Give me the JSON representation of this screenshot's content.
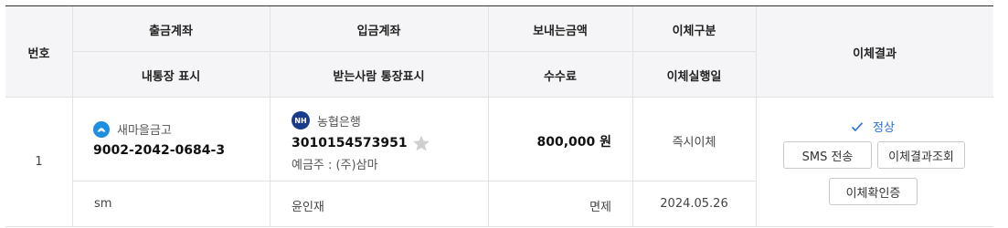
{
  "headers": {
    "number": "번호",
    "from_account": "출금계좌",
    "to_account": "입금계좌",
    "amount": "보내는금액",
    "transfer_type": "이체구분",
    "result": "이체결과",
    "my_memo": "내통장 표시",
    "recipient_memo": "받는사람 통장표시",
    "fee": "수수료",
    "transfer_date": "이체실행일"
  },
  "row": {
    "number": "1",
    "from_bank": "새마을금고",
    "from_account_no": "9002-2042-0684-3",
    "to_bank": "농협은행",
    "to_bank_logo_text": "NH",
    "to_account_no": "3010154573951",
    "depositor": "예금주 : (주)삼마",
    "amount": "800,000 원",
    "transfer_type": "즉시이체",
    "my_memo": "sm",
    "recipient_memo": "윤인재",
    "fee": "면제",
    "date": "2024.05.26",
    "status": "정상"
  },
  "buttons": {
    "sms": "SMS 전송",
    "result_inquiry": "이체결과조회",
    "confirmation": "이체확인증"
  },
  "colors": {
    "status_blue": "#2a6fd6",
    "mg_blue": "#1e8fe0",
    "nh_navy": "#1a3a8c",
    "star_gray": "#cfcfcf"
  }
}
